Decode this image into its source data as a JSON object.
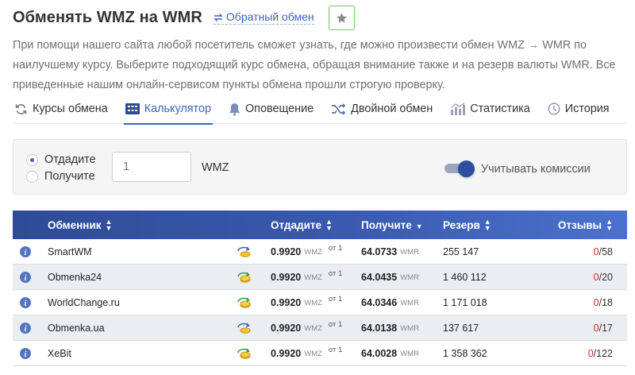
{
  "header": {
    "title": "Обменять WMZ на WMR",
    "reverse_label": "Обратный обмен"
  },
  "description": "При помощи нашего сайта любой посетитель сможет узнать, где можно произвести обмен WMZ → WMR по наилучшему курсу. Выберите подходящий курс обмена, обращая внимание также и на резерв валюты WMR. Все приведенные нашим онлайн-сервисом пункты обмена прошли строгую проверку.",
  "tabs": [
    {
      "label": "Курсы обмена",
      "icon": "refresh-icon"
    },
    {
      "label": "Калькулятор",
      "icon": "calculator-icon",
      "active": true
    },
    {
      "label": "Оповещение",
      "icon": "bell-icon"
    },
    {
      "label": "Двойной обмен",
      "icon": "shuffle-icon"
    },
    {
      "label": "Статистика",
      "icon": "chart-icon"
    },
    {
      "label": "История",
      "icon": "clock-icon"
    }
  ],
  "calculator": {
    "give_label": "Отдадите",
    "get_label": "Получите",
    "selected": "give",
    "amount_placeholder": "1",
    "currency": "WMZ",
    "commission_label": "Учитывать комиссии",
    "commission_on": true
  },
  "table": {
    "headers": {
      "exchanger": "Обменник",
      "give": "Отдадите",
      "get": "Получите",
      "reserve": "Резерв",
      "reviews": "Отзывы"
    },
    "rows": [
      {
        "name": "SmartWM",
        "give": "0.9920",
        "give_unit": "WMZ",
        "from": "от 1",
        "get": "64.0733",
        "get_unit": "WMR",
        "reserve": "255 147",
        "neg": "0",
        "sep": "/",
        "pos": "58",
        "manual": false
      },
      {
        "name": "Obmenka24",
        "give": "0.9920",
        "give_unit": "WMZ",
        "from": "от 1",
        "get": "64.0435",
        "get_unit": "WMR",
        "reserve": "1 460 112",
        "neg": "0",
        "sep": "/",
        "pos": "20",
        "manual": true
      },
      {
        "name": "WorldChange.ru",
        "give": "0.9920",
        "give_unit": "WMZ",
        "from": "от 1",
        "get": "64.0346",
        "get_unit": "WMR",
        "reserve": "1 171 018",
        "neg": "0",
        "sep": "/",
        "pos": "18",
        "manual": true
      },
      {
        "name": "Obmenka.ua",
        "give": "0.9920",
        "give_unit": "WMZ",
        "from": "от 1",
        "get": "64.0138",
        "get_unit": "WMR",
        "reserve": "137 617",
        "neg": "0",
        "sep": "/",
        "pos": "17",
        "manual": false
      },
      {
        "name": "XeBit",
        "give": "0.9920",
        "give_unit": "WMZ",
        "from": "от 1",
        "get": "64.0028",
        "get_unit": "WMR",
        "reserve": "1 358 362",
        "neg": "0",
        "sep": "/",
        "pos": "122",
        "manual": true
      }
    ]
  },
  "colors": {
    "accent": "#3b63b8",
    "header_dark": "#2e4b95",
    "header_light": "#4a72cc",
    "negative": "#d12b2b",
    "fav_border": "#7bbf6a"
  }
}
